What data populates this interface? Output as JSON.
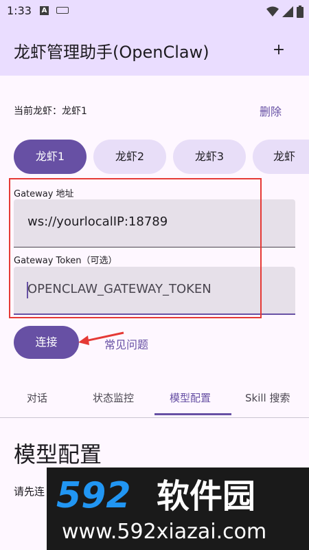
{
  "status_bar": {
    "time": "1:33",
    "a_badge": "A"
  },
  "app_bar": {
    "title": "龙虾管理助手(OpenClaw)",
    "add_label": "+"
  },
  "current": {
    "label": "当前龙虾：龙虾1",
    "delete_label": "删除"
  },
  "chips": [
    "龙虾1",
    "龙虾2",
    "龙虾3",
    "龙虾"
  ],
  "gateway_address": {
    "label": "Gateway 地址",
    "value": "ws://yourlocalIP:18789"
  },
  "gateway_token": {
    "label": "Gateway Token（可选）",
    "placeholder": "OPENCLAW_GATEWAY_TOKEN"
  },
  "actions": {
    "connect_label": "连接",
    "faq_label": "常见问题"
  },
  "tabs": [
    "对话",
    "状态监控",
    "模型配置",
    "Skill 搜索"
  ],
  "active_tab": "模型配置",
  "section": {
    "title": "模型配置",
    "hint": "请先连"
  },
  "watermark": {
    "logo_text": "592软件园",
    "url": "www.592xiazai.com"
  },
  "colors": {
    "primary": "#6750A4",
    "app_bar": "#EADDFF",
    "background": "#FEF7FF",
    "chip": "#E8DEF8",
    "annotation": "#E53935"
  }
}
